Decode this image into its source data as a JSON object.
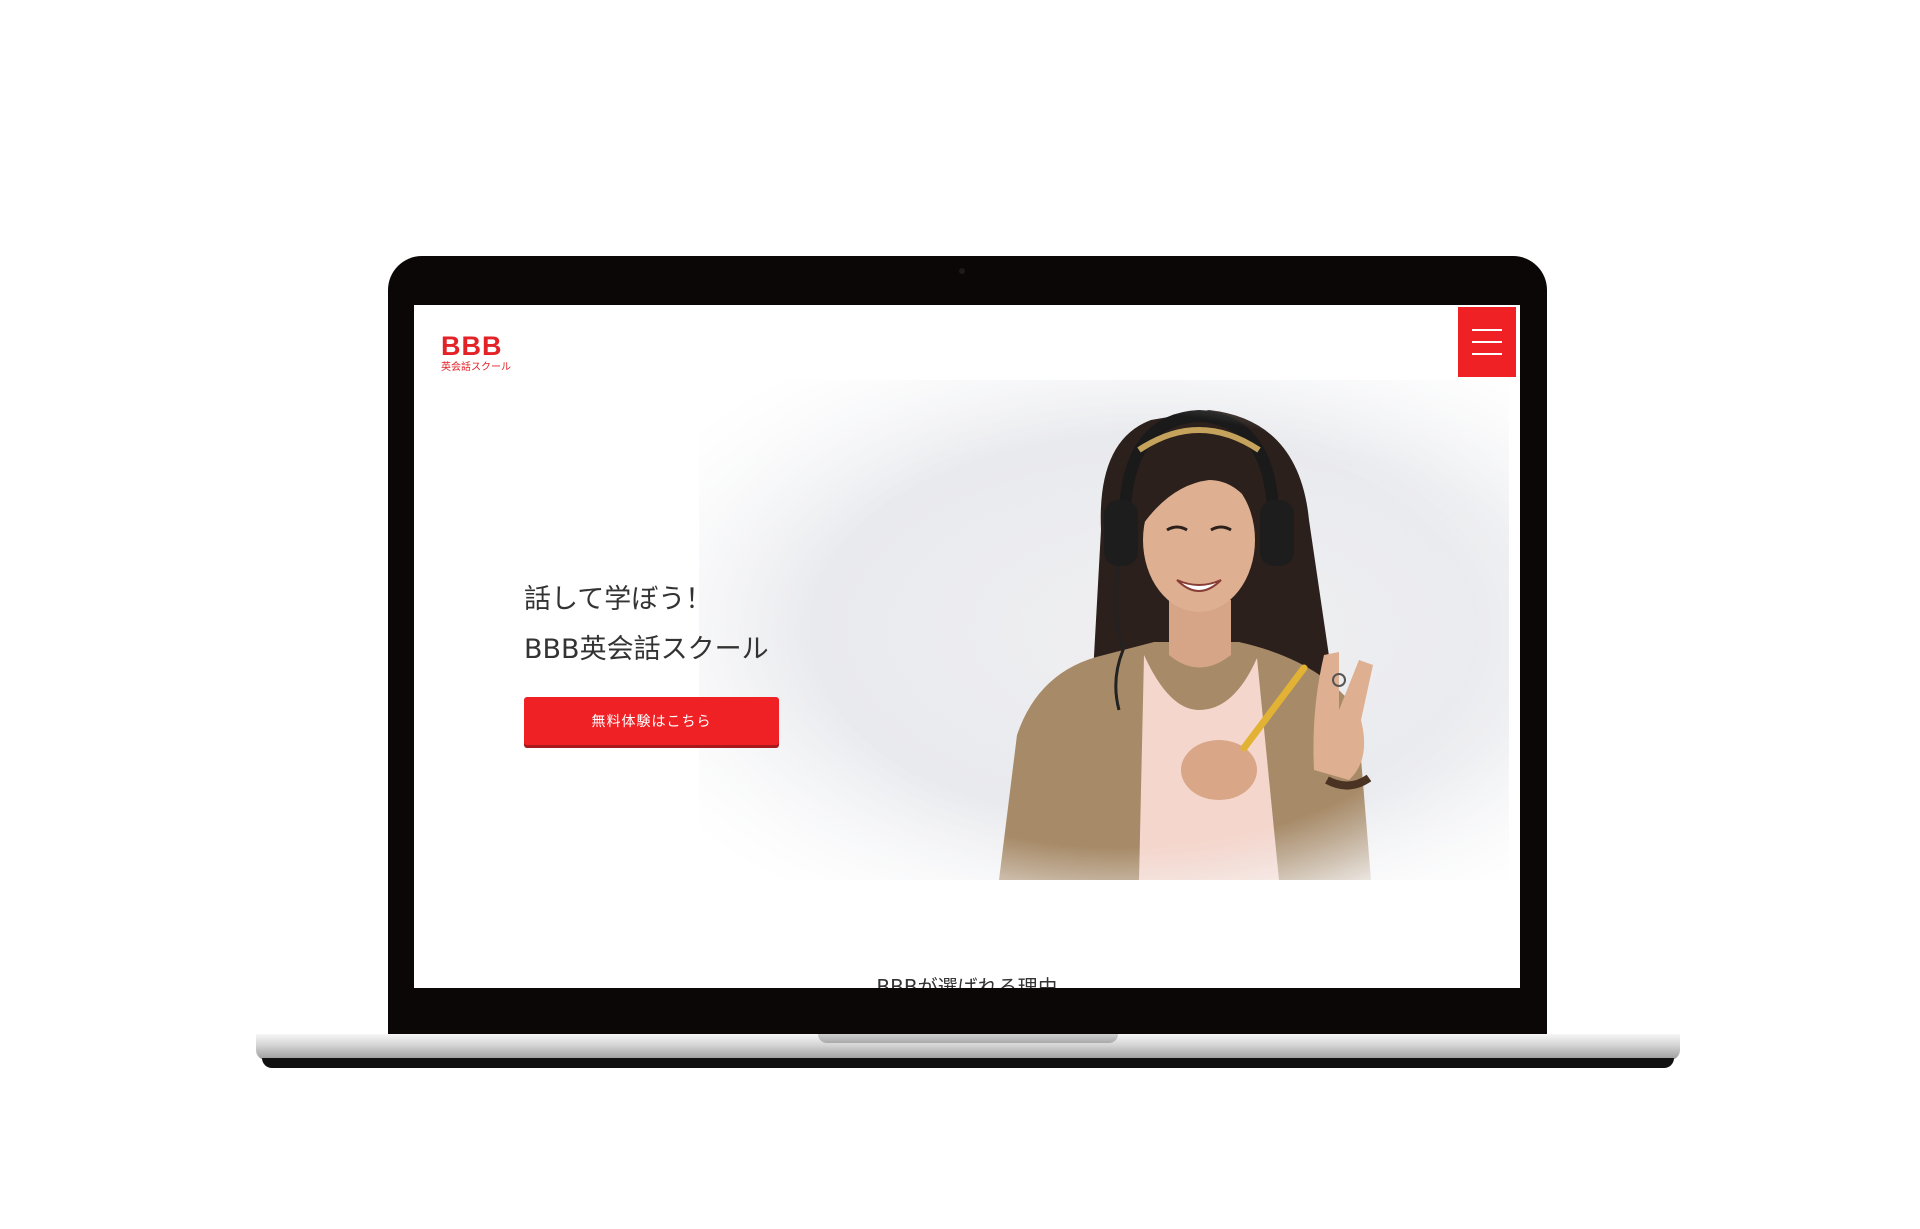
{
  "header": {
    "logo_main": "BBB",
    "logo_sub": "英会話スクール",
    "menu_icon": "hamburger-menu-icon"
  },
  "hero": {
    "headline_line1": "話して学ぼう！",
    "headline_line2": "BBB英会話スクール",
    "cta_label": "無料体験はこちら",
    "image_description_icon": "woman-with-headphones-photo"
  },
  "section": {
    "title": "BBBが選ばれる理由"
  },
  "colors": {
    "brand": "#e32227",
    "button": "#ef2125",
    "text": "#333333",
    "bezel": "#0b0707"
  }
}
